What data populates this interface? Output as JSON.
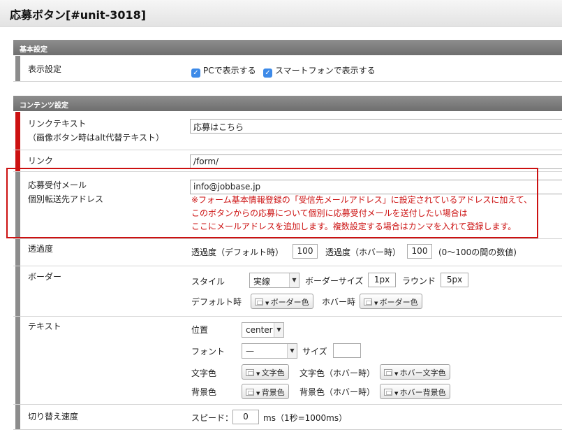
{
  "title": "応募ボタン[#unit-3018]",
  "basic": {
    "header": "基本設定",
    "display_label": "表示設定",
    "pc_label": "PCで表示する",
    "sp_label": "スマートフォンで表示する"
  },
  "content": {
    "header": "コンテンツ設定",
    "link_text_label": "リンクテキスト",
    "link_text_sub": "（画像ボタン時はalt代替テキスト）",
    "link_text_value": "応募はこちら",
    "link_label": "リンク",
    "link_value": "/form/",
    "mail_label": "応募受付メール",
    "mail_sub": "個別転送先アドレス",
    "mail_value": "info@jobbase.jp",
    "mail_note": [
      "※フォーム基本情報登録の「受信先メールアドレス」に設定されているアドレスに加えて、",
      "このボタンからの応募について個別に応募受付メールを送付したい場合は",
      "ここにメールアドレスを追加します。複数設定する場合はカンマを入れて登録します。"
    ],
    "opacity": {
      "label": "透過度",
      "default_label": "透過度（デフォルト時）",
      "default_value": "100",
      "hover_label": "透過度（ホバー時）",
      "hover_value": "100",
      "range_note": "(0〜100の間の数値)"
    },
    "border": {
      "label": "ボーダー",
      "style_label": "スタイル",
      "style_value": "実線",
      "size_label": "ボーダーサイズ",
      "size_value": "1px",
      "round_label": "ラウンド",
      "round_value": "5px",
      "default_label": "デフォルト時",
      "default_btn": "ボーダー色",
      "hover_label": "ホバー時",
      "hover_btn": "ボーダー色"
    },
    "text": {
      "label": "テキスト",
      "position_label": "位置",
      "position_value": "center",
      "font_label": "フォント",
      "font_value": "—",
      "size_label": "サイズ",
      "size_value": "",
      "color_label": "文字色",
      "color_btn": "文字色",
      "color_hover_label": "文字色（ホバー時）",
      "color_hover_btn": "ホバー文字色",
      "bg_label": "背景色",
      "bg_btn": "背景色",
      "bg_hover_label": "背景色（ホバー時）",
      "bg_hover_btn": "ホバー背景色"
    },
    "speed": {
      "label": "切り替え速度",
      "speed_label": "スピード：",
      "speed_value": "0",
      "unit": "ms（1秒=1000ms）"
    }
  },
  "colors": {
    "required": "#cc1111",
    "accent": "#3d8ae8",
    "section_header": "#7a7a7a"
  },
  "icons": {
    "check": "checkmark-icon",
    "dropdown": "chevron-down-icon",
    "swatch": "color-swatch-icon"
  }
}
